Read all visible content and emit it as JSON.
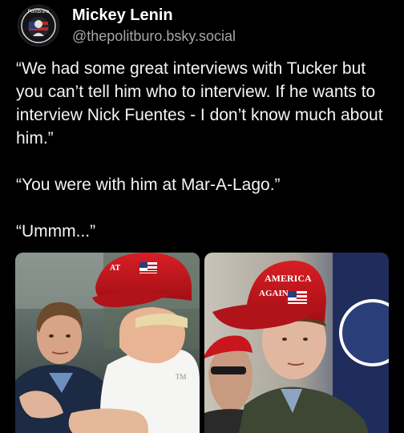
{
  "author": {
    "display_name": "Mickey Lenin",
    "handle": "@thepolitburo.bsky.social",
    "avatar_icon": "circular-badge-avatar-icon",
    "avatar_text": "Politburo"
  },
  "post": {
    "paragraphs": [
      "“We had some great interviews with Tucker but you can’t tell him who to interview. If he wants to interview Nick Fuentes - I don’t know much about him.”",
      "“You were with him at Mar-A-Lago.”",
      "“Ummm...”"
    ]
  },
  "images": {
    "left_photo_icon": "photo-tucker-and-trump",
    "right_photo_icon": "photo-man-in-red-hat",
    "hat_text_left": "AT",
    "hat_text_right_line1": "AMERICA",
    "hat_text_right_line2": "AGAIN",
    "shirt_logo": "TM"
  },
  "colors": {
    "background": "#000000",
    "text": "#f4f4f5",
    "muted": "#a5a6ab",
    "hat_red": "#c8161d"
  }
}
